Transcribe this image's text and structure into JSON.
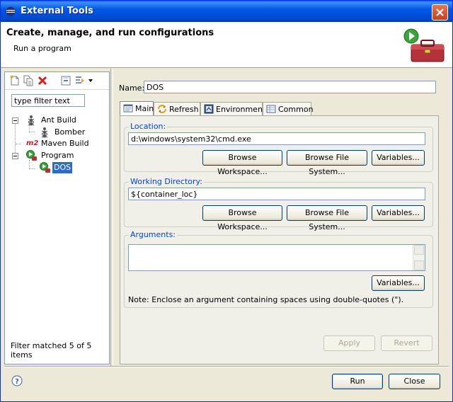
{
  "window": {
    "title": "External Tools"
  },
  "header": {
    "title": "Create, manage, and run configurations",
    "subtitle": "Run a program"
  },
  "left": {
    "filter_placeholder": "type filter text",
    "tree": [
      {
        "label": "Ant Build"
      },
      {
        "label": "Bomber"
      },
      {
        "label": "Maven Build"
      },
      {
        "label": "Program"
      },
      {
        "label": "DOS"
      }
    ],
    "status": "Filter matched 5 of 5 items"
  },
  "main": {
    "name_label": "Name:",
    "name_value": "DOS",
    "tabs": [
      {
        "label": "Main"
      },
      {
        "label": "Refresh"
      },
      {
        "label": "Environment"
      },
      {
        "label": "Common"
      }
    ],
    "location": {
      "label": "Location:",
      "value": "d:\\windows\\system32\\cmd.exe",
      "btn_workspace": "Browse Workspace...",
      "btn_filesystem": "Browse File System...",
      "btn_variables": "Variables..."
    },
    "workdir": {
      "label": "Working Directory:",
      "value": "${container_loc}",
      "btn_workspace": "Browse Workspace...",
      "btn_filesystem": "Browse File System...",
      "btn_variables": "Variables..."
    },
    "arguments": {
      "label": "Arguments:",
      "value": "",
      "btn_variables": "Variables...",
      "note": "Note: Enclose an argument containing spaces using double-quotes (\")."
    },
    "apply": "Apply",
    "revert": "Revert"
  },
  "footer": {
    "run": "Run",
    "close": "Close"
  }
}
